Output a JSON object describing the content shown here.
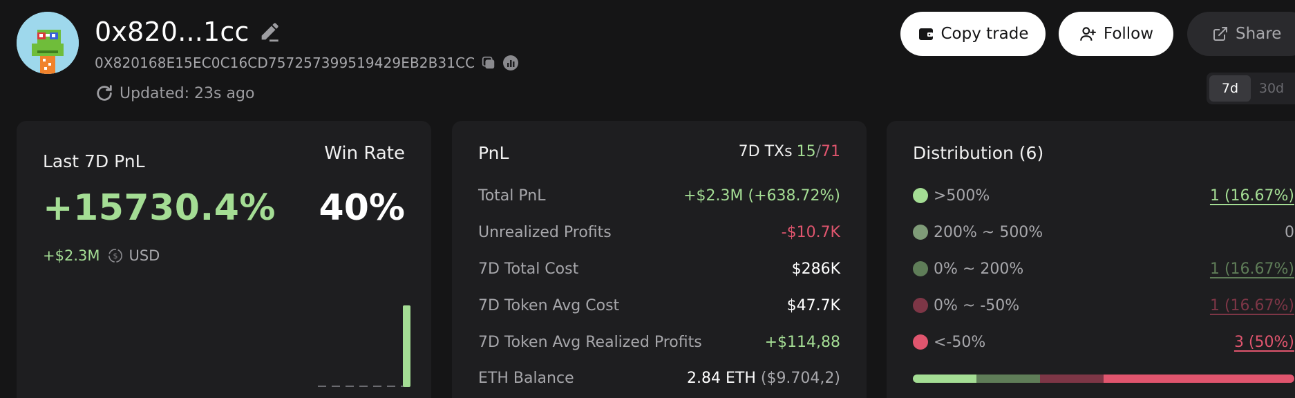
{
  "header": {
    "wallet_short": "0x820...1cc",
    "wallet_full": "0X820168E15EC0C16CD757257399519429EB2B31CC",
    "updated": "Updated: 23s ago",
    "buttons": {
      "copy_trade": "Copy trade",
      "follow": "Follow",
      "share": "Share"
    },
    "periods": [
      {
        "label": "7d",
        "active": true
      },
      {
        "label": "30d",
        "active": false
      }
    ]
  },
  "pnl_card": {
    "label": "Last 7D PnL",
    "pnl_percent": "+15730.4%",
    "pnl_usd": "+$2.3M",
    "unit": "USD",
    "win_rate_label": "Win Rate",
    "win_rate": "40%"
  },
  "stats_card": {
    "title": "PnL",
    "txs_label": "7D TXs",
    "txs_win": "15",
    "txs_sep": "/",
    "txs_loss": "71",
    "rows": [
      {
        "label": "Total PnL",
        "value": "+$2.3M (+638.72%)",
        "tone": "pos"
      },
      {
        "label": "Unrealized Profits",
        "value": "-$10.7K",
        "tone": "neg"
      },
      {
        "label": "7D Total Cost",
        "value": "$286K",
        "tone": "neutral"
      },
      {
        "label": "7D Token Avg Cost",
        "value": "$47.7K",
        "tone": "neutral"
      },
      {
        "label": "7D Token Avg Realized Profits",
        "value": "+$114,88",
        "tone": "pos"
      },
      {
        "label": "ETH Balance",
        "value": "2.84 ETH",
        "value_extra": "($9.704,2)",
        "tone": "neutral"
      }
    ]
  },
  "distribution_card": {
    "title": "Distribution (6)",
    "rows": [
      {
        "label": ">500%",
        "count": "1 (16.67%)",
        "color": "#a4dd94",
        "share": 1,
        "underlined": true
      },
      {
        "label": "200% ~ 500%",
        "count": "0",
        "color": "#7f9c78",
        "share": 0,
        "underlined": false
      },
      {
        "label": "0% ~ 200%",
        "count": "1 (16.67%)",
        "color": "#5f7d58",
        "share": 1,
        "underlined": true
      },
      {
        "label": "0% ~ -50%",
        "count": "1 (16.67%)",
        "color": "#7d3646",
        "share": 1,
        "underlined": true
      },
      {
        "label": "<-50%",
        "count": "3 (50%)",
        "color": "#e0556e",
        "share": 3,
        "underlined": true
      }
    ]
  },
  "colors": {
    "positive": "#a4dd94",
    "negative": "#e0556e",
    "card_bg": "#1e1e20",
    "page_bg": "#151516"
  },
  "icons": [
    "edit-icon",
    "copy-icon",
    "chart-icon",
    "refresh-icon",
    "wallet-icon",
    "user-plus-icon",
    "share-icon",
    "currency-icon"
  ]
}
